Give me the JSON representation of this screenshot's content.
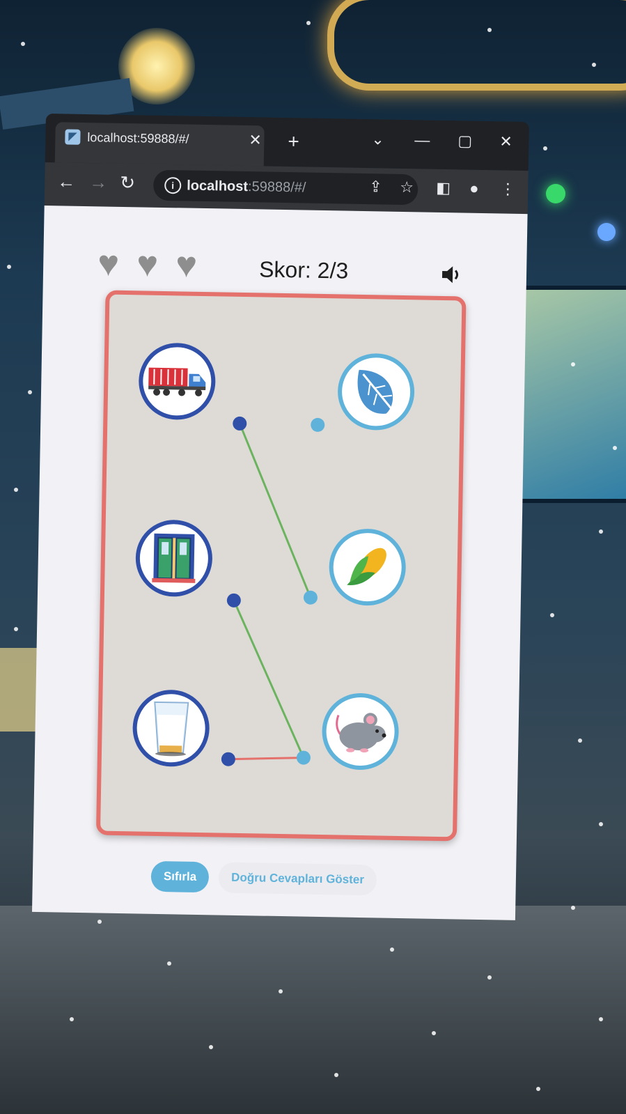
{
  "browser": {
    "tab_title": "localhost:59888/#/",
    "url_host": "localhost",
    "url_rest": ":59888/#/"
  },
  "game": {
    "lives": 3,
    "score_text": "Skor: 2/3",
    "left_items": [
      {
        "name": "truck",
        "icon": "truck-icon"
      },
      {
        "name": "door",
        "icon": "door-icon"
      },
      {
        "name": "milk-glass",
        "icon": "milk-glass-icon"
      }
    ],
    "right_items": [
      {
        "name": "leaf",
        "icon": "leaf-icon"
      },
      {
        "name": "corn",
        "icon": "corn-icon"
      },
      {
        "name": "mouse",
        "icon": "mouse-icon"
      }
    ],
    "connections": [
      {
        "from": 0,
        "to": 1,
        "status": "correct",
        "color": "#6bb35f"
      },
      {
        "from": 1,
        "to": 2,
        "status": "correct",
        "color": "#6bb35f"
      },
      {
        "from": 2,
        "to": 2,
        "status": "wrong",
        "color": "#e4716c"
      }
    ],
    "reset_label": "Sıfırla",
    "show_answers_label": "Doğru Cevapları Göster"
  },
  "colors": {
    "board_border": "#e4716c",
    "left_node": "#2f4fa8",
    "right_node": "#5fb3db"
  }
}
